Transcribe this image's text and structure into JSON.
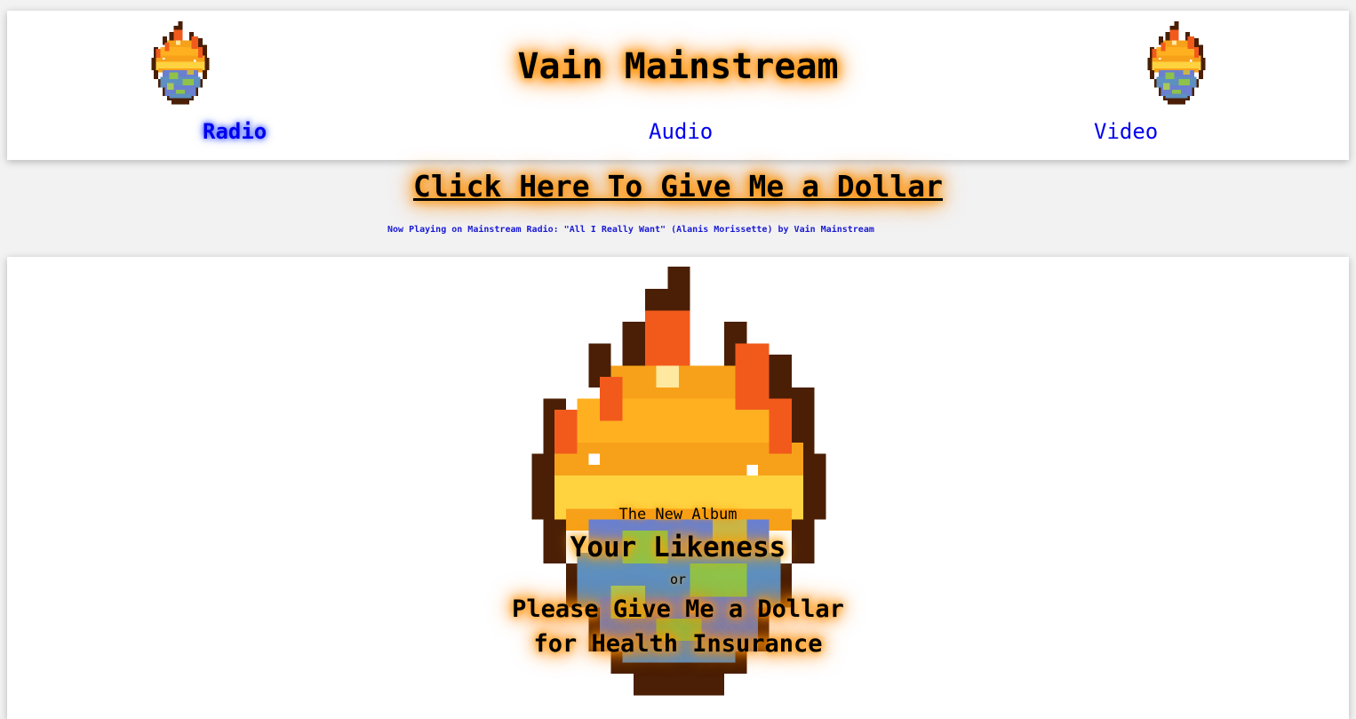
{
  "header": {
    "title": "Vain Mainstream",
    "logo_icon": "burning-earth-icon"
  },
  "nav": {
    "radio": "Radio",
    "audio": "Audio",
    "video": "Video"
  },
  "donate": {
    "label": "Click Here To Give Me a Dollar"
  },
  "now_playing": {
    "text": "Now Playing on Mainstream Radio: \"All I Really Want\" (Alanis Morissette) by Vain Mainstream"
  },
  "album": {
    "kicker": "The New Album",
    "title": "Your Likeness",
    "or": "or",
    "subtitle_line1": "Please Give Me a Dollar",
    "subtitle_line2": "for Health Insurance"
  },
  "colors": {
    "link": "#0000ee",
    "glow": "#ff8c00",
    "fire_dark": "#4a1f05",
    "fire_red": "#f25a1c",
    "fire_orange": "#f7a11a",
    "fire_yellow": "#ffd23f",
    "earth_blue": "#6a7fd0",
    "earth_green": "#8fc24a"
  }
}
